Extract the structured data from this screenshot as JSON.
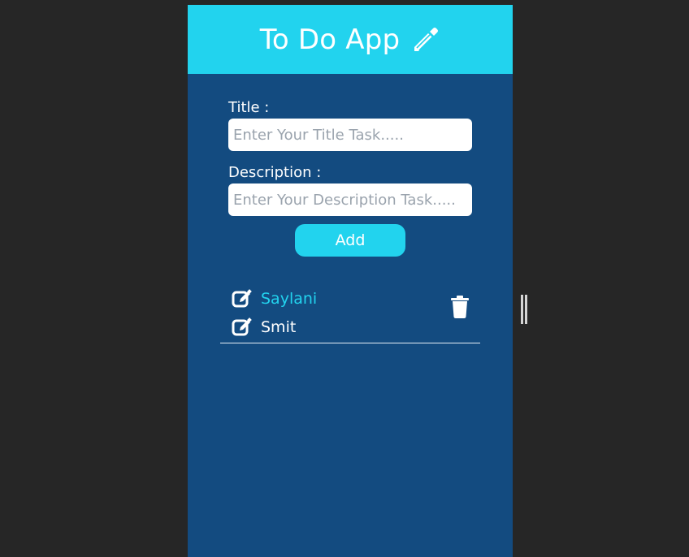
{
  "header": {
    "title": "To Do App",
    "icon": "pencil-icon"
  },
  "form": {
    "title_label": "Title :",
    "title_placeholder": "Enter Your Title Task.....",
    "title_value": "",
    "description_label": "Description :",
    "description_placeholder": "Enter Your Description Task.....",
    "description_value": "",
    "add_label": "Add"
  },
  "todos": [
    {
      "title": "Saylani",
      "description": "Smit",
      "icons": [
        "edit-icon",
        "edit-icon",
        "trash-icon"
      ]
    }
  ],
  "colors": {
    "page_background": "#262626",
    "app_background": "#134b80",
    "accent": "#22d3ee",
    "text": "#ffffff"
  }
}
